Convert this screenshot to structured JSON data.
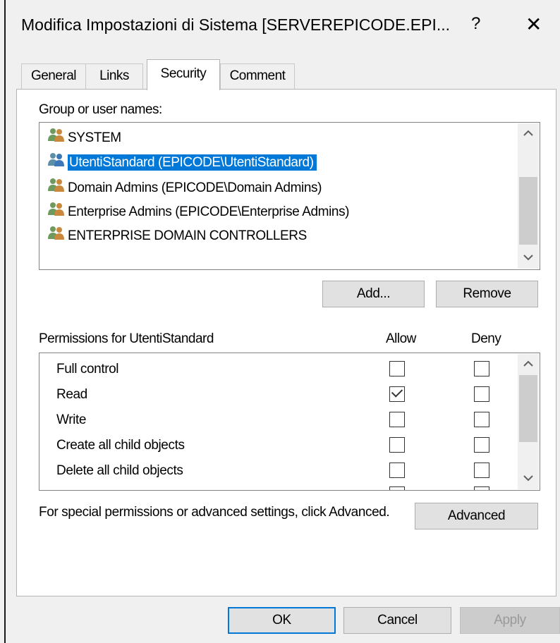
{
  "window": {
    "title": "Modifica Impostazioni di Sistema [SERVEREPICODE.EPI...",
    "help_label": "?",
    "close_label": "✕"
  },
  "tabs": [
    {
      "label": "General",
      "active": false
    },
    {
      "label": "Links",
      "active": false
    },
    {
      "label": "Security",
      "active": true
    },
    {
      "label": "Comment",
      "active": false
    }
  ],
  "groups": {
    "label": "Group or user names:",
    "items": [
      {
        "name": "SYSTEM",
        "selected": false
      },
      {
        "name": "UtentiStandard (EPICODE\\UtentiStandard)",
        "selected": true
      },
      {
        "name": "Domain Admins (EPICODE\\Domain Admins)",
        "selected": false
      },
      {
        "name": "Enterprise Admins (EPICODE\\Enterprise Admins)",
        "selected": false
      },
      {
        "name": "ENTERPRISE DOMAIN CONTROLLERS",
        "selected": false
      }
    ],
    "add_label": "Add...",
    "remove_label": "Remove"
  },
  "permissions": {
    "header": "Permissions for UtentiStandard",
    "allow_label": "Allow",
    "deny_label": "Deny",
    "rows": [
      {
        "name": "Full control",
        "allow": false,
        "deny": false
      },
      {
        "name": "Read",
        "allow": true,
        "deny": false
      },
      {
        "name": "Write",
        "allow": false,
        "deny": false
      },
      {
        "name": "Create all child objects",
        "allow": false,
        "deny": false
      },
      {
        "name": "Delete all child objects",
        "allow": false,
        "deny": false
      }
    ]
  },
  "advanced": {
    "text": "For special permissions or advanced settings, click Advanced.",
    "button_label": "Advanced"
  },
  "footer": {
    "ok_label": "OK",
    "cancel_label": "Cancel",
    "apply_label": "Apply"
  },
  "colors": {
    "selection": "#0078d7",
    "background": "#f0f0f0"
  },
  "icons": {
    "user_group": "users-icon",
    "scroll_up": "chevron-up-icon",
    "scroll_down": "chevron-down-icon"
  }
}
